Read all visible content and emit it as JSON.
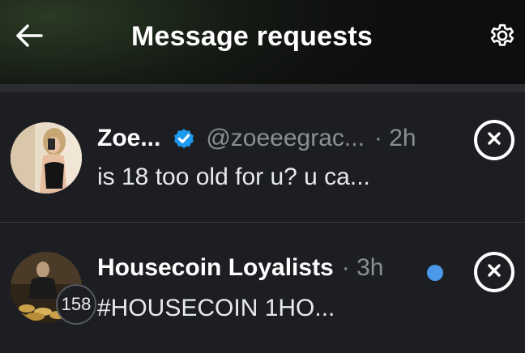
{
  "header": {
    "title": "Message requests",
    "back_icon": "arrow-left-icon",
    "settings_icon": "gear-icon"
  },
  "requests": [
    {
      "name": "Zoe...",
      "verified": true,
      "handle": "@zoeeegrac...",
      "time": "· 2h",
      "preview": "is 18 too old for u? u ca...",
      "unread": false
    },
    {
      "name": "Housecoin Loyalists",
      "time": "· 3h",
      "preview": "#HOUSECOIN 1HO...",
      "member_count": "158",
      "unread": true
    }
  ],
  "colors": {
    "background": "#1c1e22",
    "verified_blue": "#1d9bf0",
    "unread_dot": "#4a99e9",
    "muted_text": "#8b8f95"
  }
}
